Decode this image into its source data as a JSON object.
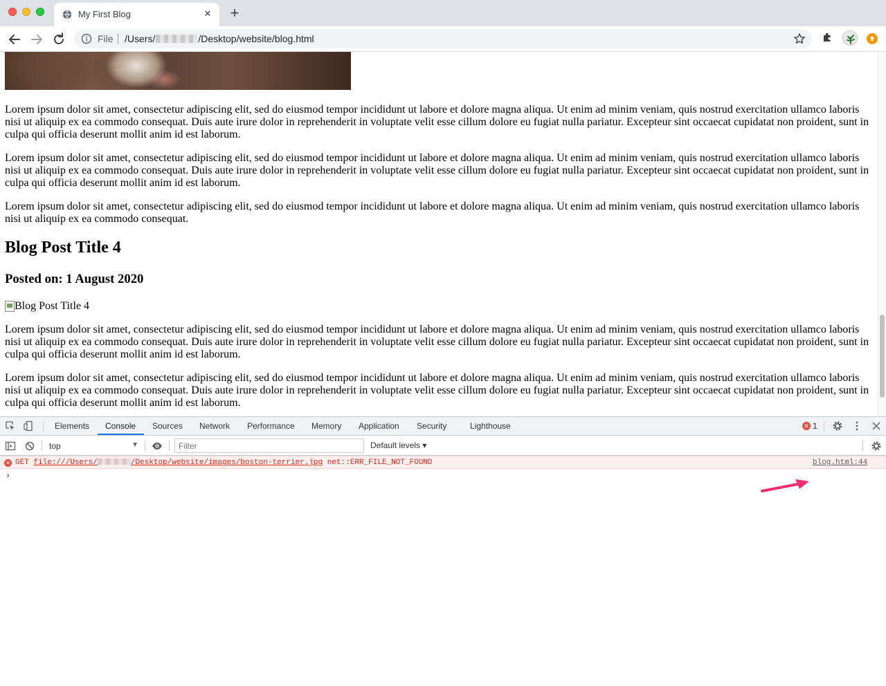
{
  "browser": {
    "tab": {
      "title": "My First Blog",
      "close_label": "✕"
    },
    "newtab_label": "+",
    "omnibox": {
      "scheme_chip": "File",
      "url_before": "/Users/",
      "url_after": "/Desktop/website/blog.html"
    }
  },
  "page": {
    "paragraphs_top": [
      "Lorem ipsum dolor sit amet, consectetur adipiscing elit, sed do eiusmod tempor incididunt ut labore et dolore magna aliqua. Ut enim ad minim veniam, quis nostrud exercitation ullamco laboris nisi ut aliquip ex ea commodo consequat. Duis aute irure dolor in reprehenderit in voluptate velit esse cillum dolore eu fugiat nulla pariatur. Excepteur sint occaecat cupidatat non proident, sunt in culpa qui officia deserunt mollit anim id est laborum.",
      "Lorem ipsum dolor sit amet, consectetur adipiscing elit, sed do eiusmod tempor incididunt ut labore et dolore magna aliqua. Ut enim ad minim veniam, quis nostrud exercitation ullamco laboris nisi ut aliquip ex ea commodo consequat. Duis aute irure dolor in reprehenderit in voluptate velit esse cillum dolore eu fugiat nulla pariatur. Excepteur sint occaecat cupidatat non proident, sunt in culpa qui officia deserunt mollit anim id est laborum.",
      "Lorem ipsum dolor sit amet, consectetur adipiscing elit, sed do eiusmod tempor incididunt ut labore et dolore magna aliqua. Ut enim ad minim veniam, quis nostrud exercitation ullamco laboris nisi ut aliquip ex ea commodo consequat."
    ],
    "post": {
      "title": "Blog Post Title 4",
      "posted_on": "Posted on: 1 August 2020",
      "image_alt": "Blog Post Title 4",
      "paragraphs": [
        "Lorem ipsum dolor sit amet, consectetur adipiscing elit, sed do eiusmod tempor incididunt ut labore et dolore magna aliqua. Ut enim ad minim veniam, quis nostrud exercitation ullamco laboris nisi ut aliquip ex ea commodo consequat. Duis aute irure dolor in reprehenderit in voluptate velit esse cillum dolore eu fugiat nulla pariatur. Excepteur sint occaecat cupidatat non proident, sunt in culpa qui officia deserunt mollit anim id est laborum.",
        "Lorem ipsum dolor sit amet, consectetur adipiscing elit, sed do eiusmod tempor incididunt ut labore et dolore magna aliqua. Ut enim ad minim veniam, quis nostrud exercitation ullamco laboris nisi ut aliquip ex ea commodo consequat. Duis aute irure dolor in reprehenderit in voluptate velit esse cillum dolore eu fugiat nulla pariatur. Excepteur sint occaecat cupidatat non proident, sunt in culpa qui officia deserunt mollit anim id est laborum."
      ]
    }
  },
  "devtools": {
    "tabs": [
      "Elements",
      "Console",
      "Sources",
      "Network",
      "Performance",
      "Memory",
      "Application",
      "Security",
      "Lighthouse"
    ],
    "active_tab": "Console",
    "error_count": "1",
    "context": "top",
    "filter_placeholder": "Filter",
    "levels_label": "Default levels ▾",
    "message": {
      "method": "GET",
      "url_before": "file:///Users/",
      "url_after": "/Desktop/website/images/boston-terrier.jpg",
      "error": "net::ERR_FILE_NOT_FOUND",
      "source": "blog.html:44"
    },
    "prompt": "›"
  },
  "colors": {
    "tabstrip": "#dee1e6",
    "devtools_active_underline": "#1a73e8",
    "console_error_text": "#e0261b",
    "console_error_bg": "#fff0f0",
    "annotation_arrow": "#f0306e"
  },
  "icons": [
    "globe-icon",
    "back-icon",
    "forward-icon",
    "reload-icon",
    "info-icon",
    "star-icon",
    "extensions-puzzle-icon",
    "inspect-element-icon",
    "device-toolbar-icon",
    "settings-gear-icon",
    "kebab-menu-icon",
    "close-icon",
    "sidebar-toggle-icon",
    "clear-console-icon",
    "eye-icon",
    "error-icon"
  ]
}
